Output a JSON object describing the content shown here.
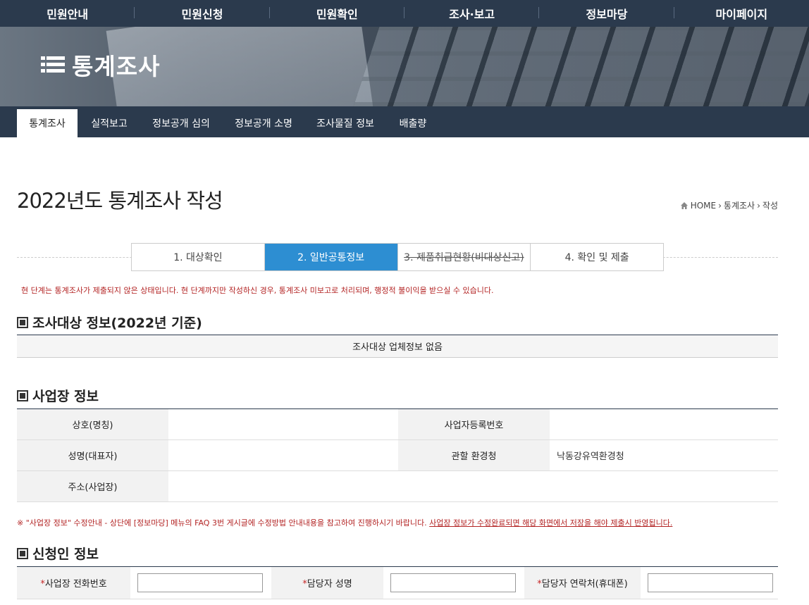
{
  "top_nav": {
    "items": [
      "민원안내",
      "민원신청",
      "민원확인",
      "조사·보고",
      "정보마당",
      "마이페이지"
    ]
  },
  "banner": {
    "title": "통계조사",
    "icon": "list-icon"
  },
  "sub_nav": {
    "items": [
      "통계조사",
      "실적보고",
      "정보공개 심의",
      "정보공개 소명",
      "조사물질 정보",
      "배출량"
    ],
    "active": "통계조사"
  },
  "page": {
    "title": "2022년도 통계조사 작성",
    "breadcrumb": [
      "HOME",
      "통계조사",
      "작성"
    ]
  },
  "steps": {
    "items": [
      "1. 대상확인",
      "2. 일반공통정보",
      "3. 제품취급현황(비대상신고)",
      "4. 확인 및 제출"
    ],
    "active": "2. 일반공통정보",
    "disabled": "3. 제품취급현황(비대상신고)"
  },
  "notice": "현 단계는 통계조사가 제출되지 않은 상태입니다. 현 단계까지만 작성하신 경우, 통계조사 미보고로 처리되며, 행정적 불이익을 받으실 수 있습니다.",
  "survey_target": {
    "heading": "조사대상 정보(2022년 기준)",
    "empty_message": "조사대상 업체정보 없음"
  },
  "business": {
    "heading": "사업장 정보",
    "labels": {
      "company_name": "상호(명칭)",
      "reg_number": "사업자등록번호",
      "representative": "성명(대표자)",
      "env_office": "관할 환경청",
      "address": "주소(사업장)"
    },
    "values": {
      "company_name": "",
      "reg_number": "",
      "representative": "",
      "env_office": "낙동강유역환경청",
      "address": ""
    }
  },
  "faq_note": {
    "main": "※ \"사업장 정보\" 수정안내 - 상단에 [정보마당] 메뉴의 FAQ 3번 게시글에 수정방법 안내내용을 참고하여 진행하시기 바랍니다. ",
    "underlined": "사업장 정보가 수정완료되면 해당 화면에서 저장을 해야 제출시 반영됩니다."
  },
  "applicant": {
    "heading": "신청인 정보",
    "required_mark": "*",
    "fields": [
      {
        "label": "사업장 전화번호",
        "value": ""
      },
      {
        "label": "담당자 성명",
        "value": ""
      },
      {
        "label": "담당자 연락처(휴대폰)",
        "value": ""
      }
    ]
  },
  "colors": {
    "nav_bg": "#2b3a4d",
    "step_active": "#2d8ed2",
    "notice_red": "#b32424"
  }
}
